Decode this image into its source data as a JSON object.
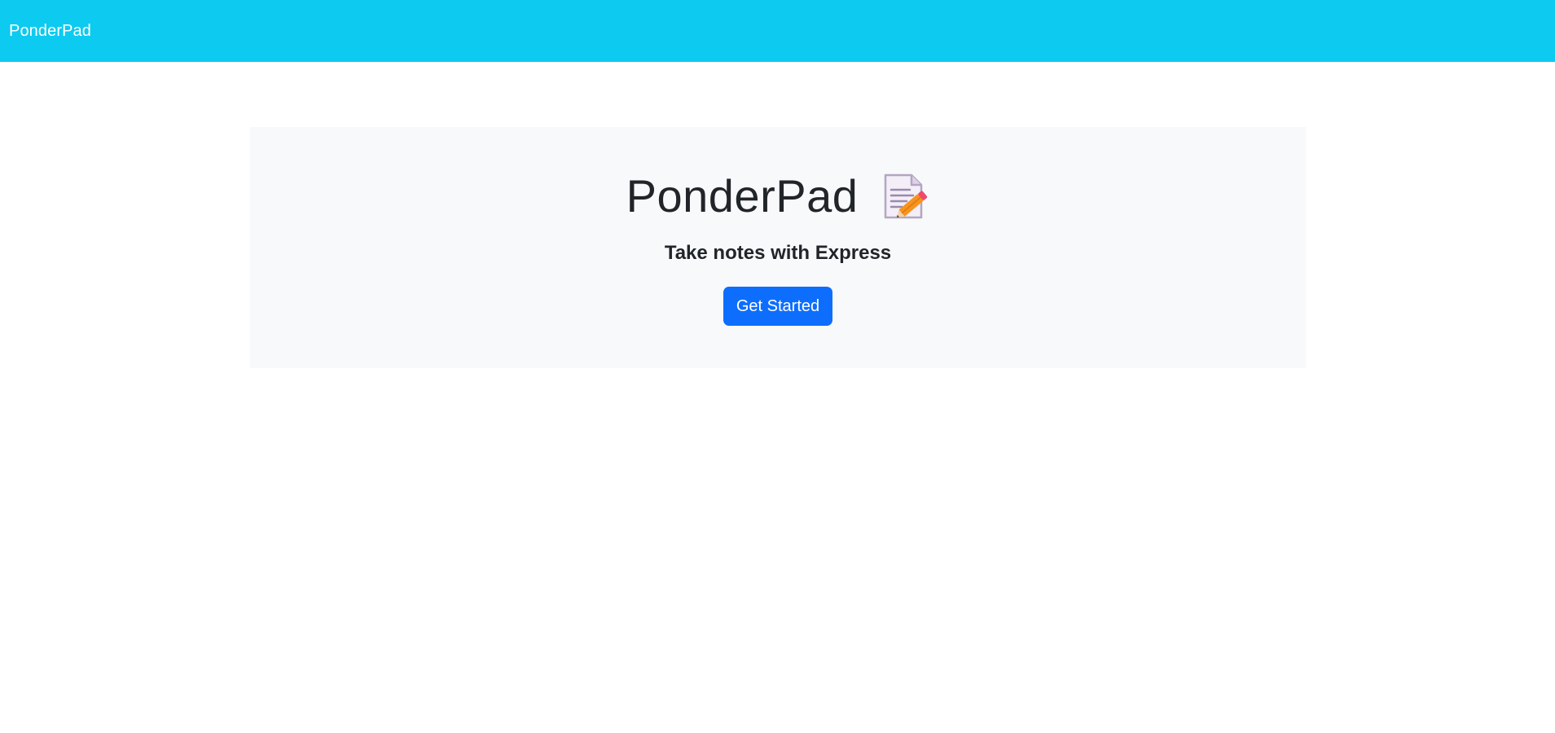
{
  "navbar": {
    "brand": "PonderPad",
    "background": "#0dcaf0"
  },
  "hero": {
    "title": "PonderPad",
    "title_icon": "memo-icon",
    "subtitle": "Take notes with Express",
    "cta_label": "Get Started",
    "cta_color": "#0d6efd",
    "panel_background": "#f8f9fa"
  }
}
